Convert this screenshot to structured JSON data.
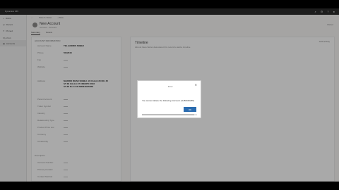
{
  "app": {
    "title": "Dynamics 365"
  },
  "nav": {
    "items": [
      {
        "label": "Home"
      },
      {
        "label": "Recent"
      },
      {
        "label": "Pinned"
      }
    ],
    "section": "My Work",
    "active_item": "Accounts"
  },
  "record": {
    "title": "New Account",
    "subtitle": "Account · Account",
    "save_label": "Save & Close",
    "new_label": "+ New",
    "owner": "Owner"
  },
  "tabs": [
    "Summary",
    "Details"
  ],
  "form": {
    "section_link": "ACCOUNT INFORMATION",
    "fields": [
      {
        "label": "Account Name",
        "value": "TEL BADRIS SOBEJ"
      },
      {
        "label": "Phone",
        "value": "5012043"
      },
      {
        "label": "Fax",
        "value": ""
      },
      {
        "label": "Website",
        "value": ""
      },
      {
        "label": "Address",
        "value": ""
      },
      {
        "label": "Parent Account",
        "value": ""
      },
      {
        "label": "Ticker Symbol",
        "value": ""
      },
      {
        "label": "Industry",
        "value": ""
      },
      {
        "label": "Relationship Type",
        "value": ""
      },
      {
        "label": "Product Price List",
        "value": ""
      },
      {
        "label": "Currency",
        "value": ""
      },
      {
        "label": "Created By",
        "value": ""
      }
    ],
    "address_lines": [
      "MADRID ROAD SOBEJ, 10 CALLE 20 NO. 35",
      "ST 38 CALLE 37 CRESPO 2016",
      "ST-38 No 12-35 MINEJEMARE"
    ],
    "lower_section": "Description",
    "lower_fields": [
      {
        "label": "Account Number"
      },
      {
        "label": "Primary Contact"
      },
      {
        "label": "Contact Method"
      },
      {
        "label": "Email"
      }
    ]
  },
  "timeline": {
    "title": "Timeline",
    "text": "Almost there! Enter data about this record to add a timeline",
    "action": "Add activity"
  },
  "dialog": {
    "title": "Error",
    "message": "You cannot delete the following: Account. (0x80040265)",
    "ok_label": "OK",
    "progress": 0.95
  }
}
